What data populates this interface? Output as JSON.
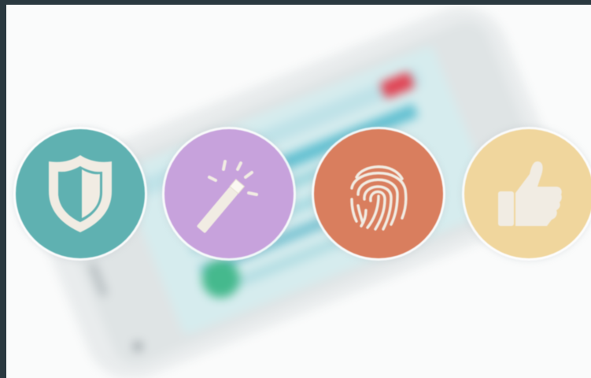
{
  "scene": {
    "background_color": "#2a3940",
    "photo_background": "#fafbfb",
    "subject": "blurred-smartphone-icon"
  },
  "badges": [
    {
      "name": "shield-badge",
      "icon": "shield-icon",
      "color": "#5fb1b1"
    },
    {
      "name": "magic-wand-badge",
      "icon": "magic-wand-icon",
      "color": "#c7a2dc"
    },
    {
      "name": "fingerprint-badge",
      "icon": "fingerprint-icon",
      "color": "#d97e5e"
    },
    {
      "name": "thumbs-up-badge",
      "icon": "thumbs-up-icon",
      "color": "#f0d69d"
    }
  ],
  "icon_glyph_color": "#f1ece3"
}
